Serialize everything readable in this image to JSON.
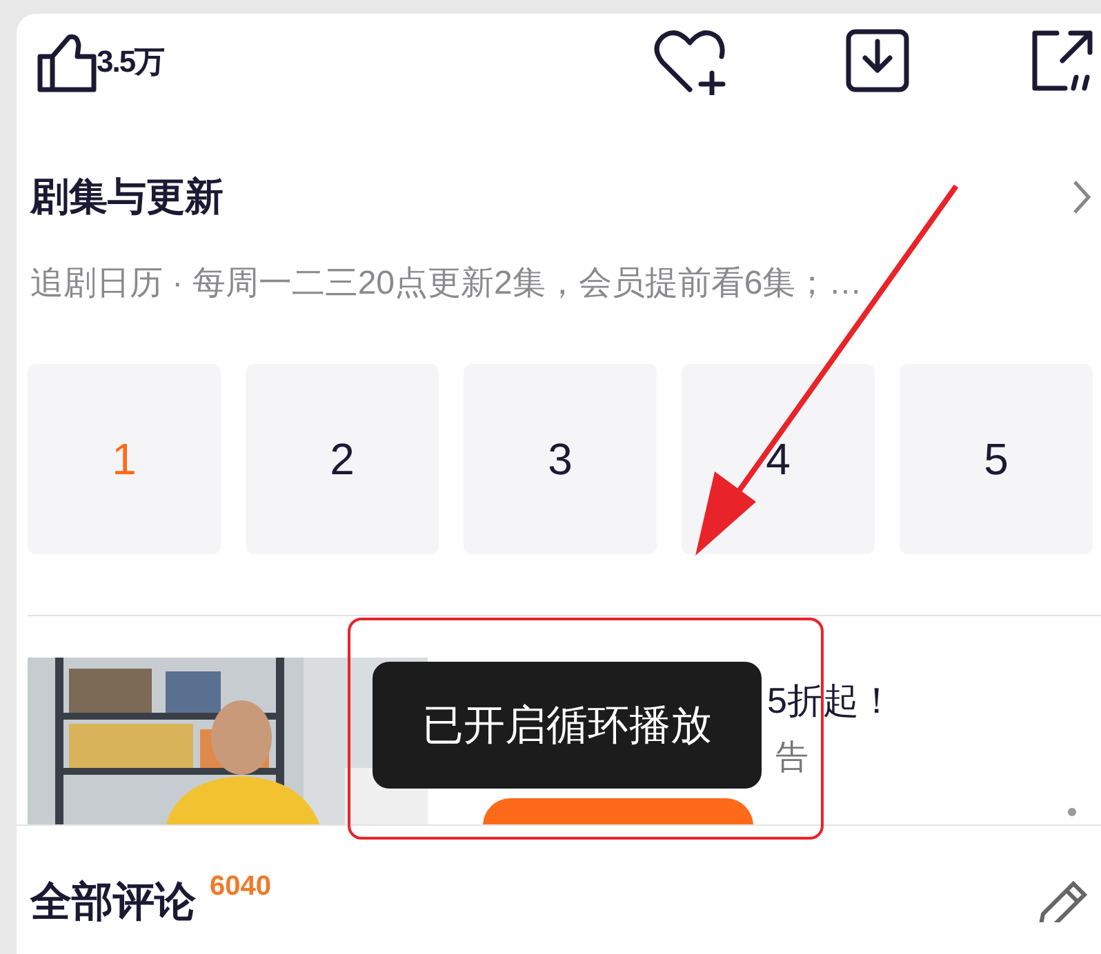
{
  "toolbar": {
    "likes": "3.5万"
  },
  "episodes_section": {
    "title": "剧集与更新",
    "subtitle": "追剧日历 · 每周一二三20点更新2集，会员提前看6集；…",
    "episodes": [
      {
        "label": "1",
        "selected": true
      },
      {
        "label": "2",
        "selected": false
      },
      {
        "label": "3",
        "selected": false
      },
      {
        "label": "4",
        "selected": false
      },
      {
        "label": "5",
        "selected": false
      }
    ]
  },
  "ad": {
    "title": "5折起！",
    "sponsor": "告"
  },
  "toast": {
    "text": "已开启循环播放"
  },
  "comments": {
    "title": "全部评论",
    "count": "6040"
  }
}
